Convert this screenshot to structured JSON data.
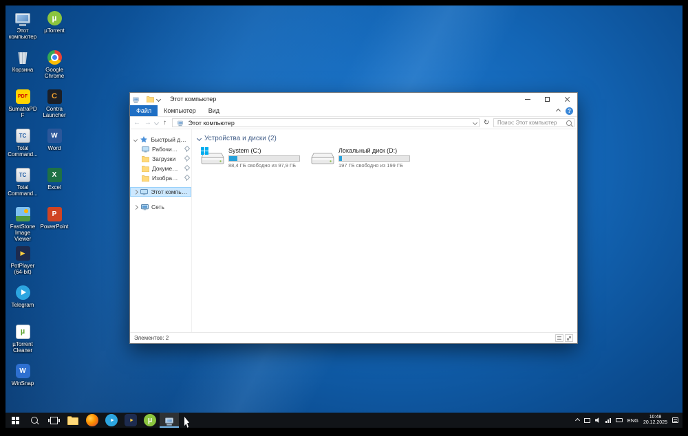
{
  "desktop": {
    "col1": [
      {
        "icon": "this-pc",
        "label": "Этот компьютер"
      },
      {
        "icon": "recycle-bin",
        "label": "Корзина"
      },
      {
        "icon": "sumatrapdf",
        "label": "SumatraPDF"
      },
      {
        "icon": "total-commander",
        "label": "Total Command..."
      },
      {
        "icon": "total-commander",
        "label": "Total Command..."
      },
      {
        "icon": "faststone",
        "label": "FastStone Image Viewer"
      },
      {
        "icon": "potplayer",
        "label": "PotPlayer (64-bit)"
      },
      {
        "icon": "telegram",
        "label": "Telegram"
      },
      {
        "icon": "utorrent-cleaner",
        "label": "µTorrent Cleaner"
      },
      {
        "icon": "winsnap",
        "label": "WinSnap"
      }
    ],
    "col2": [
      {
        "icon": "utorrent",
        "label": "µTorrent"
      },
      {
        "icon": "google-chrome",
        "label": "Google Chrome"
      },
      {
        "icon": "contra-launcher",
        "label": "Contra Launcher"
      },
      {
        "icon": "word",
        "label": "Word"
      },
      {
        "icon": "excel",
        "label": "Excel"
      },
      {
        "icon": "powerpoint",
        "label": "PowerPoint"
      }
    ]
  },
  "explorer": {
    "title": "Этот компьютер",
    "help": "?",
    "tabs": {
      "file": "Файл",
      "computer": "Компьютер",
      "view": "Вид"
    },
    "breadcrumb": "Этот компьютер",
    "search_placeholder": "Поиск: Этот компьютер",
    "nav": {
      "quick_access": "Быстрый доступ",
      "desktop": "Рабочий стол",
      "downloads": "Загрузки",
      "documents": "Документы",
      "pictures": "Изображения",
      "this_pc": "Этот компьютер",
      "network": "Сеть"
    },
    "group_header": "Устройства и диски (2)",
    "drives": [
      {
        "name": "System (C:)",
        "free": "88,4 ГБ свободно из 97,9 ГБ",
        "used_percent": 12
      },
      {
        "name": "Локальный диск (D:)",
        "free": "197 ГБ свободно из 199 ГБ",
        "used_percent": 4
      }
    ],
    "status": "Элементов: 2"
  },
  "taskbar": {
    "buttons": [
      "start",
      "search",
      "task-view",
      "file-explorer",
      "firefox",
      "telegram",
      "potplayer",
      "utorrent",
      "this-pc-active"
    ],
    "tray": {
      "language": "ENG",
      "time": "10:48",
      "date": "20.12.2025"
    }
  },
  "glyphs": {
    "back": "←",
    "forward": "→",
    "up": "↑",
    "refresh": "↻"
  },
  "colors": {
    "accent": "#1f6fc4",
    "selection": "#cce8ff",
    "progress": "#26a0da",
    "taskbar": "#111418"
  }
}
